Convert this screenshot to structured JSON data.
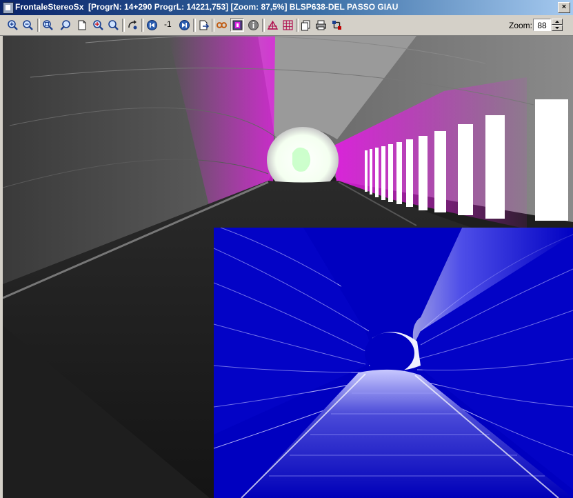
{
  "window": {
    "title": "FrontaleStereoSx  [ProgrN: 14+290 ProgrL: 14221,753] [Zoom: 87,5%] BLSP638-DEL PASSO GIAU",
    "close_glyph": "×"
  },
  "toolbar": {
    "buttons": [
      {
        "name": "zoom-in-icon",
        "icon": "magnifier-plus"
      },
      {
        "name": "zoom-out-icon",
        "icon": "magnifier-minus"
      },
      {
        "name": "zoom-area-icon",
        "icon": "magnifier-area"
      },
      {
        "name": "zoom-pan-icon",
        "icon": "magnifier-hand"
      },
      {
        "name": "page-icon",
        "icon": "blank-page"
      },
      {
        "name": "zoom-fit-icon",
        "icon": "magnifier-fit"
      },
      {
        "name": "zoom-reset-icon",
        "icon": "magnifier-reset"
      },
      {
        "name": "rotate-icon",
        "icon": "rotate-arrows"
      },
      {
        "name": "previous-frame-icon",
        "icon": "skip-back"
      },
      {
        "name": "next-frame-icon",
        "icon": "skip-forward"
      },
      {
        "name": "export-icon",
        "icon": "page-arrow"
      },
      {
        "name": "stereo-icon",
        "icon": "infinity-glasses"
      },
      {
        "name": "overlay-icon",
        "icon": "image-overlay"
      },
      {
        "name": "info-icon",
        "icon": "info-circle"
      },
      {
        "name": "tunnel-profile-icon",
        "icon": "profile-grid"
      },
      {
        "name": "grid-icon",
        "icon": "grid"
      },
      {
        "name": "copy-icon",
        "icon": "copy-pages"
      },
      {
        "name": "print-icon",
        "icon": "printer"
      },
      {
        "name": "settings-icon",
        "icon": "tool-nodes"
      }
    ],
    "step_value": "-1",
    "zoom_label": "Zoom:",
    "zoom_value": "88"
  },
  "colors": {
    "titlebar_start": "#0a246a",
    "toolbar_bg": "#d4d0c8",
    "tunnel_highlight": "#e020e0",
    "lidar_background": "#0000c0"
  }
}
